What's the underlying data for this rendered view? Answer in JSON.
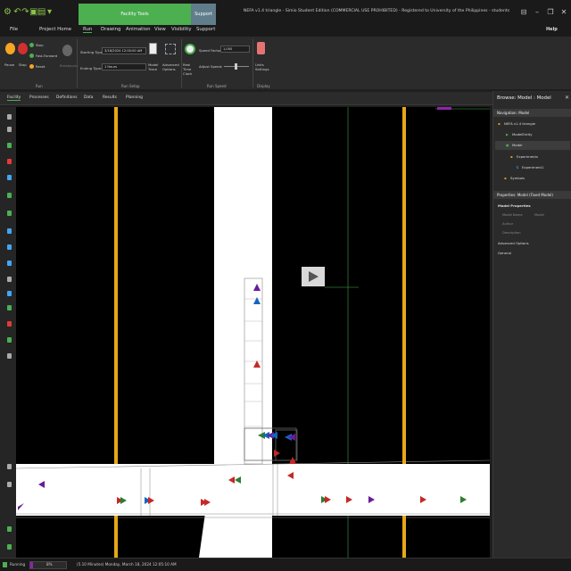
{
  "window": {
    "title": "NEFA v1.4 triangle - Simio Student Edition (COMMERCIAL USE PROHIBITED) - Registered to University of the Philippines - students",
    "context_tab": "Facility Tools",
    "support_tab": "Support",
    "help": "Help"
  },
  "menu": [
    "File",
    "Project Home",
    "Run",
    "Drawing",
    "Animation",
    "View",
    "Visibility",
    "Support"
  ],
  "ribbon": {
    "run_group": {
      "label": "Run",
      "pause": "Pause",
      "stop": "Stop",
      "step": "Step",
      "fast_forward": "Fast-Forward",
      "reset": "Reset",
      "breakpoint": "Breakpoint"
    },
    "run_setup": {
      "label": "Run Setup",
      "starting_type_label": "Starting Type:",
      "starting_type_value": "3/18/2024 12:00:00 AM",
      "ending_type_label": "Ending Type:",
      "ending_type_value": "1 Hours",
      "model_trace": "Model Trace",
      "advanced_options": "Advanced Options"
    },
    "run_speed": {
      "label": "Run Speed",
      "real_time_clock": "Real Time Clock",
      "speed_factor_label": "Speed Factor:",
      "speed_factor_value": "1,000",
      "adjust_speed": "Adjust Speed:"
    },
    "display": {
      "label": "Display",
      "units_settings": "Units Settings"
    }
  },
  "window_tabs": [
    "Facility",
    "Processes",
    "Definitions",
    "Data",
    "Results",
    "Planning"
  ],
  "browse": {
    "title": "Browse: Model : Model",
    "nav_header": "Navigation: Model",
    "tree": [
      "NEFA v1.4 triangle",
      "ModelEntity",
      "Model",
      "Experiments",
      "Experiment1",
      "Symbols"
    ],
    "props_header": "Properties: Model (Fixed Model)",
    "model_properties": "Model Properties",
    "model_name_label": "Model Name",
    "model_name_value": "Model",
    "author_label": "Author",
    "description_label": "Description",
    "advanced_options": "Advanced Options",
    "general": "General"
  },
  "status": {
    "state": "Running",
    "progress_percent": "8%",
    "progress_fraction": 0.08,
    "sim_time": "(5.10 Minutes) Monday, March 18, 2024 12:05:10 AM"
  },
  "colors": {
    "accent": "#4caf50",
    "road_line": "#e6a817",
    "entity_red": "#c62828",
    "entity_green": "#2e7d32",
    "entity_purple": "#6a1b9a",
    "entity_blue": "#1565c0"
  }
}
